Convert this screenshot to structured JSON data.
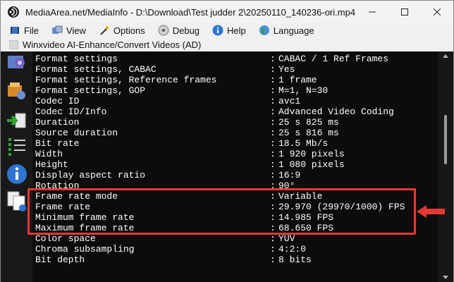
{
  "window": {
    "title": "MediaArea.net/MediaInfo - D:\\Download\\Test judder 2\\20250110_140236-ori.mp4"
  },
  "menu": {
    "items": [
      "File",
      "View",
      "Options",
      "Debug",
      "Help",
      "Language"
    ],
    "secondary": "Winxvideo AI-Enhance/Convert Videos (AD)"
  },
  "rows": [
    {
      "key": "Format settings",
      "value": "CABAC / 1 Ref Frames"
    },
    {
      "key": "Format settings, CABAC",
      "value": "Yes"
    },
    {
      "key": "Format settings, Reference frames",
      "value": "1 frame"
    },
    {
      "key": "Format settings, GOP",
      "value": "M=1, N=30"
    },
    {
      "key": "Codec ID",
      "value": "avc1"
    },
    {
      "key": "Codec ID/Info",
      "value": "Advanced Video Coding"
    },
    {
      "key": "Duration",
      "value": "25 s 825 ms"
    },
    {
      "key": "Source duration",
      "value": "25 s 816 ms"
    },
    {
      "key": "Bit rate",
      "value": "18.5 Mb/s"
    },
    {
      "key": "Width",
      "value": "1 920 pixels"
    },
    {
      "key": "Height",
      "value": "1 080 pixels"
    },
    {
      "key": "Display aspect ratio",
      "value": "16:9"
    },
    {
      "key": "Rotation",
      "value": "90°"
    },
    {
      "key": "Frame rate mode",
      "value": "Variable"
    },
    {
      "key": "Frame rate",
      "value": "29.970 (29970/1000) FPS"
    },
    {
      "key": "Minimum frame rate",
      "value": "14.985 FPS"
    },
    {
      "key": "Maximum frame rate",
      "value": "68.650 FPS"
    },
    {
      "key": "Color space",
      "value": "YUV"
    },
    {
      "key": "Chroma subsampling",
      "value": "4:2:0"
    },
    {
      "key": "Bit depth",
      "value": "8 bits"
    }
  ],
  "separator": ":",
  "colors": {
    "background": "#0c0c0c",
    "text": "#ffffff",
    "highlight": "#e53935"
  }
}
